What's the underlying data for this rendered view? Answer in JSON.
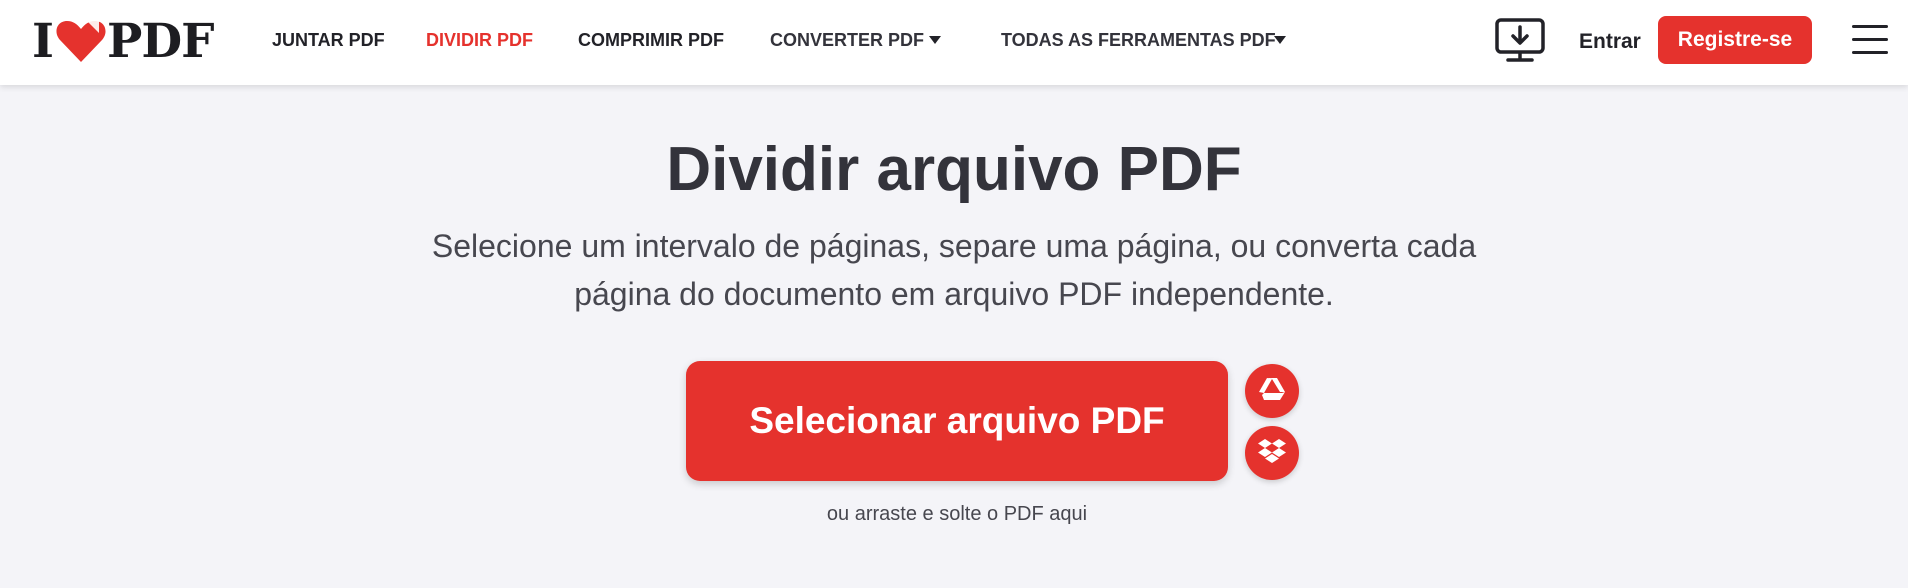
{
  "header": {
    "logo": {
      "prefix": "I",
      "suffix": "PDF",
      "icon": "heart-icon"
    },
    "nav": [
      {
        "label": "JUNTAR PDF",
        "active": false
      },
      {
        "label": "DIVIDIR PDF",
        "active": true
      },
      {
        "label": "COMPRIMIR PDF",
        "active": false
      },
      {
        "label": "CONVERTER PDF",
        "dropdown": true
      },
      {
        "label": "TODAS AS FERRAMENTAS PDF",
        "dropdown": true
      }
    ],
    "desktop_icon": "desktop-download-icon",
    "login_label": "Entrar",
    "register_label": "Registre-se",
    "menu_icon": "hamburger-menu-icon"
  },
  "main": {
    "title": "Dividir arquivo PDF",
    "subtitle_line1": "Selecione um intervalo de páginas, separe uma página, ou converta cada",
    "subtitle_line2": "página do documento em arquivo PDF independente.",
    "select_button_label": "Selecionar arquivo PDF",
    "cloud_sources": [
      {
        "icon": "google-drive-icon"
      },
      {
        "icon": "dropbox-icon"
      }
    ],
    "drop_hint": "ou arraste e solte o PDF aqui"
  },
  "colors": {
    "brand_red": "#e5322d",
    "background": "#f4f4f8",
    "text_dark": "#33333b"
  }
}
